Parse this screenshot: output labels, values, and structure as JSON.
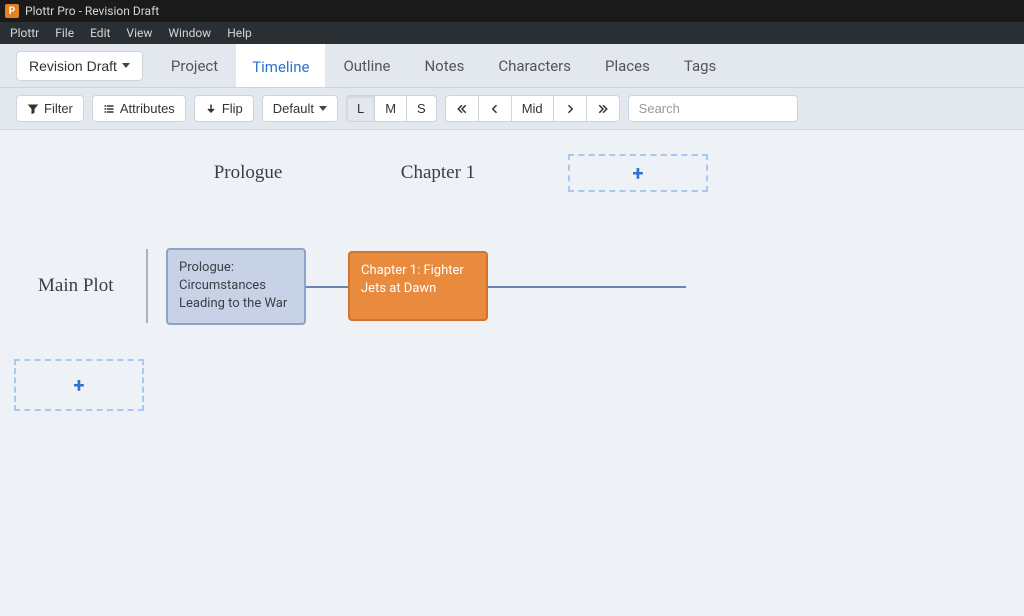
{
  "window": {
    "app_icon_letter": "P",
    "title": "Plottr Pro - Revision Draft"
  },
  "menu": {
    "items": [
      "Plottr",
      "File",
      "Edit",
      "View",
      "Window",
      "Help"
    ]
  },
  "nav": {
    "draft_button": "Revision Draft",
    "tabs": [
      "Project",
      "Timeline",
      "Outline",
      "Notes",
      "Characters",
      "Places",
      "Tags"
    ],
    "active_tab": "Timeline"
  },
  "toolbar": {
    "filter": "Filter",
    "attributes": "Attributes",
    "flip": "Flip",
    "default": "Default",
    "zoom": {
      "L": "L",
      "M": "M",
      "S": "S"
    },
    "paginate": {
      "mid": "Mid"
    },
    "search_placeholder": "Search"
  },
  "timeline": {
    "chapters": [
      "Prologue",
      "Chapter 1"
    ],
    "plotlines": [
      {
        "name": "Main Plot",
        "scenes": [
          {
            "title": "Prologue: Circumstances Leading to the War",
            "color": "blue"
          },
          {
            "title": "Chapter 1: Fighter Jets at Dawn",
            "color": "orange"
          }
        ]
      }
    ],
    "add_symbol": "+"
  }
}
